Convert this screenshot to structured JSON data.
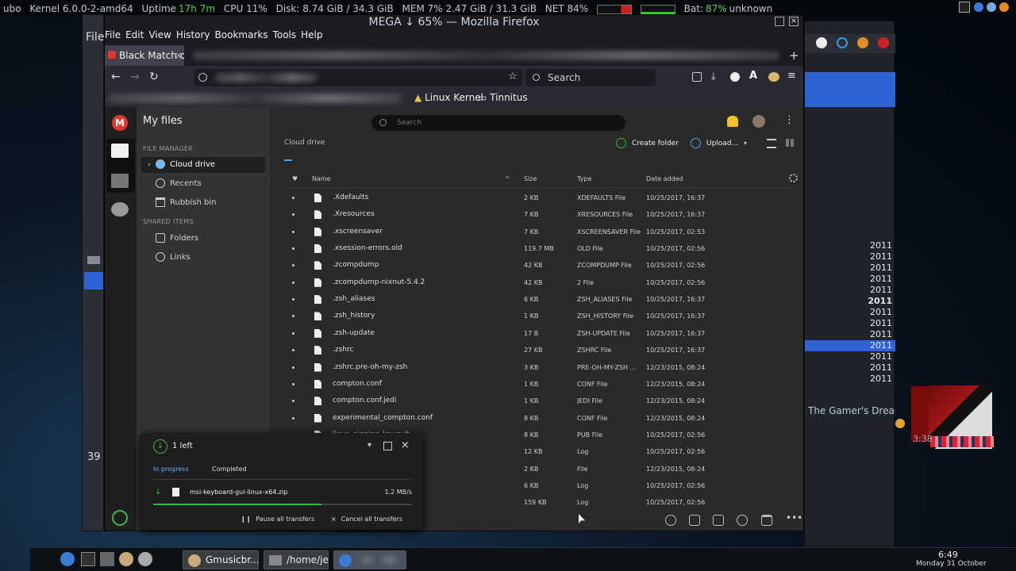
{
  "statusbar": {
    "host": "ubo",
    "kernel": "Kernel 6.0.0-2-amd64",
    "uptime_label": "Uptime",
    "uptime_value": "17h 7m",
    "cpu": "CPU 11%",
    "disk": "Disk: 8.74 GiB / 34.3 GiB",
    "mem": "MEM 7% 2.47 GiB / 31.3 GiB",
    "net": "NET 84%",
    "bat_label": "Bat:",
    "bat_value": "87%",
    "bat_state": "unknown"
  },
  "window": {
    "title": "MEGA ↓ 65% — Mozilla Firefox",
    "bg_label": "File"
  },
  "menubar": [
    "File",
    "Edit",
    "View",
    "History",
    "Bookmarks",
    "Tools",
    "Help"
  ],
  "tab": {
    "label": "Black Match o"
  },
  "nav": {
    "search_placeholder": "Search"
  },
  "bookmarks": [
    {
      "label": "Linux Kernel"
    },
    {
      "label": "Tinnitus"
    }
  ],
  "mega": {
    "logo": "M",
    "title": "My files",
    "search_placeholder": "Search",
    "section_file_manager": "FILE MANAGER",
    "section_shared": "SHARED ITEMS",
    "side_items": [
      "Cloud drive",
      "Recents",
      "Rubbish bin"
    ],
    "shared_items": [
      "Folders",
      "Links"
    ],
    "breadcrumb": "Cloud drive",
    "create_folder": "Create folder",
    "upload": "Upload...",
    "columns": {
      "name": "Name",
      "size": "Size",
      "type": "Type",
      "date": "Date added"
    },
    "files": [
      {
        "name": ".Xdefaults",
        "size": "2 KB",
        "type": "XDEFAULTS File",
        "date": "10/25/2017, 16:37"
      },
      {
        "name": ".Xresources",
        "size": "7 KB",
        "type": "XRESOURCES File",
        "date": "10/25/2017, 16:37"
      },
      {
        "name": ".xscreensaver",
        "size": "7 KB",
        "type": "XSCREENSAVER File",
        "date": "10/25/2017, 02:53"
      },
      {
        "name": ".xsession-errors.old",
        "size": "119.7 MB",
        "type": "OLD File",
        "date": "10/25/2017, 02:56"
      },
      {
        "name": ".zcompdump",
        "size": "42 KB",
        "type": "ZCOMPDUMP File",
        "date": "10/25/2017, 02:56"
      },
      {
        "name": ".zcompdump-nixnut-5.4.2",
        "size": "42 KB",
        "type": "2 File",
        "date": "10/25/2017, 02:56"
      },
      {
        "name": ".zsh_aliases",
        "size": "6 KB",
        "type": "ZSH_ALIASES File",
        "date": "10/25/2017, 16:37"
      },
      {
        "name": ".zsh_history",
        "size": "1 KB",
        "type": "ZSH_HISTORY File",
        "date": "10/25/2017, 16:37"
      },
      {
        "name": ".zsh-update",
        "size": "17 B",
        "type": "ZSH-UPDATE File",
        "date": "10/25/2017, 16:37"
      },
      {
        "name": ".zshrc",
        "size": "27 KB",
        "type": "ZSHRC File",
        "date": "10/25/2017, 16:37"
      },
      {
        "name": ".zshrc.pre-oh-my-zsh",
        "size": "3 KB",
        "type": "PRE-OH-MY-ZSH ...",
        "date": "12/23/2015, 08:24"
      },
      {
        "name": "compton.conf",
        "size": "1 KB",
        "type": "CONF File",
        "date": "12/23/2015, 08:24"
      },
      {
        "name": "compton.conf.jedi",
        "size": "1 KB",
        "type": "JEDI File",
        "date": "12/23/2015, 08:24"
      },
      {
        "name": "experimental_compton.conf",
        "size": "8 KB",
        "type": "CONF File",
        "date": "12/23/2015, 08:24"
      },
      {
        "name": "linux_signing_key.pub",
        "size": "8 KB",
        "type": "PUB File",
        "date": "10/25/2017, 02:56"
      },
      {
        "name": "",
        "size": "12 KB",
        "type": "Log",
        "date": "10/25/2017, 02:56"
      },
      {
        "name": "",
        "size": "2 KB",
        "type": "File",
        "date": "12/23/2015, 08:24"
      },
      {
        "name": "",
        "size": "6 KB",
        "type": "Log",
        "date": "10/25/2017, 02:56"
      },
      {
        "name": "",
        "size": "159 KB",
        "type": "Log",
        "date": "10/25/2017, 02:56"
      }
    ]
  },
  "transfers": {
    "count": "1 left",
    "tab_progress": "In progress",
    "tab_completed": "Completed",
    "file": "msi-keyboard-gui-linux-x64.zip",
    "speed": "1.2 MB/s",
    "progress": 0.65,
    "pause": "Pause all transfers",
    "cancel": "Cancel all transfers"
  },
  "right": {
    "years": [
      "2011",
      "2011",
      "2011",
      "2011",
      "2011",
      "2011",
      "2011",
      "2011",
      "2011",
      "2011",
      "2011",
      "2011",
      "2011"
    ],
    "music_title": "The Gamer's Dream",
    "time": "3:38",
    "number": "39"
  },
  "taskbar": {
    "tasks": [
      "Gmusicbr...",
      "/home/jedi"
    ],
    "clock_time": "6:49",
    "clock_date": "Monday 31 October"
  }
}
